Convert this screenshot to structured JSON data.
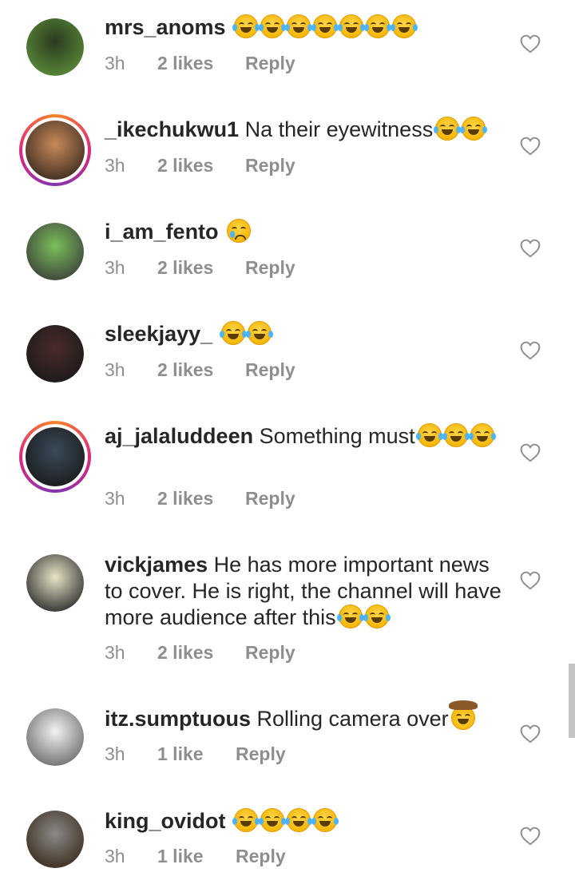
{
  "comments": [
    {
      "username": "mrs_anoms",
      "text": "",
      "emoji": [
        "laugh",
        "laugh",
        "laugh",
        "laugh",
        "laugh",
        "laugh",
        "laugh"
      ],
      "time": "3h",
      "likes": "2 likes",
      "reply": "Reply",
      "avatar_colors": [
        "#2b3a1e",
        "#5a8c3a"
      ],
      "story_ring": false
    },
    {
      "username": "_ikechukwu1",
      "text": "Na their eyewitness",
      "emoji": [
        "laugh",
        "laugh"
      ],
      "time": "3h",
      "likes": "2 likes",
      "reply": "Reply",
      "avatar_colors": [
        "#c98a5a",
        "#3a2a20"
      ],
      "story_ring": true
    },
    {
      "username": "i_am_fento",
      "text": "",
      "emoji": [
        "sad"
      ],
      "time": "3h",
      "likes": "2 likes",
      "reply": "Reply",
      "avatar_colors": [
        "#7cbf5a",
        "#3a3f3a"
      ],
      "story_ring": false
    },
    {
      "username": "sleekjayy_",
      "text": "",
      "emoji": [
        "laugh",
        "laugh"
      ],
      "time": "3h",
      "likes": "2 likes",
      "reply": "Reply",
      "avatar_colors": [
        "#4a2a2a",
        "#1a1a1a"
      ],
      "story_ring": false
    },
    {
      "username": "aj_jalaluddeen",
      "text": "Something must",
      "emoji": [
        "laugh",
        "laugh",
        "laugh"
      ],
      "time": "3h",
      "likes": "2 likes",
      "reply": "Reply",
      "avatar_colors": [
        "#3a4a5a",
        "#1a1a1a"
      ],
      "story_ring": true
    },
    {
      "username": "vickjames",
      "text": "He has more important news to cover. He is right, the channel will have more audience after this",
      "emoji": [
        "laugh",
        "laugh"
      ],
      "time": "3h",
      "likes": "2 likes",
      "reply": "Reply",
      "avatar_colors": [
        "#e8e4c8",
        "#2a2a2a"
      ],
      "story_ring": false
    },
    {
      "username": "itz.sumptuous",
      "text": "Rolling camera over",
      "emoji": [
        "cowboy"
      ],
      "time": "3h",
      "likes": "1 like",
      "reply": "Reply",
      "avatar_colors": [
        "#f2f2f2",
        "#6a6a6a"
      ],
      "story_ring": false
    },
    {
      "username": "king_ovidot",
      "text": "",
      "emoji": [
        "laugh",
        "laugh",
        "laugh",
        "laugh"
      ],
      "time": "3h",
      "likes": "1 like",
      "reply": "Reply",
      "avatar_colors": [
        "#8a8a8a",
        "#3a2a1a"
      ],
      "story_ring": false
    }
  ],
  "icons": {
    "like": "heart-outline-icon"
  },
  "colors": {
    "text": "#262626",
    "meta": "#8e8e8e",
    "heart": "#8e8e8e",
    "background": "#ffffff"
  }
}
